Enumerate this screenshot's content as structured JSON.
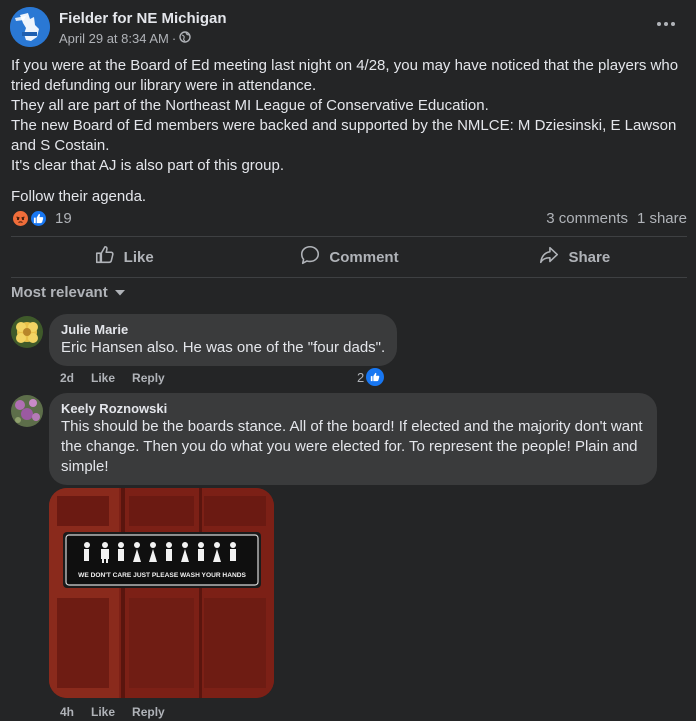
{
  "post": {
    "page_name": "Fielder for NE Michigan",
    "date": "April 29 at 8:34 AM",
    "separator": "·",
    "paragraphs": [
      "If you were at the Board of Ed meeting last night on 4/28, you may have noticed that the players who tried defunding our library were in attendance.",
      "They all are part of the Northeast MI League of Conservative Education.",
      "The new Board of Ed members were backed and supported by the NMLCE: M Dziesinski, E Lawson and S Costain.",
      "It's clear that AJ is also part of this group."
    ],
    "closing": "Follow their agenda.",
    "reaction_count": "19",
    "comments_count": "3 comments",
    "shares_count": "1 share"
  },
  "actions": {
    "like": "Like",
    "comment": "Comment",
    "share": "Share"
  },
  "sort": {
    "label": "Most relevant"
  },
  "comments": [
    {
      "author": "Julie Marie",
      "text": "Eric Hansen also. He was one of the \"four dads\".",
      "time": "2d",
      "like": "Like",
      "reply": "Reply",
      "reactions": "2"
    },
    {
      "author": "Keely Roznowski",
      "text": "This should be the boards stance. All of the board! If elected and the majority don't want the change. Then you do what you were elected for. To represent the people! Plain and simple!",
      "image_sign_text": "WE DON'T CARE JUST PLEASE WASH YOUR HANDS",
      "time": "4h",
      "like": "Like",
      "reply": "Reply"
    }
  ],
  "icons": {
    "globe": "globe-icon",
    "more": "more-icon",
    "like": "thumbs-up-icon",
    "comment": "comment-bubble-icon",
    "share": "share-arrow-icon",
    "dropdown": "chevron-down-icon"
  },
  "colors": {
    "background": "#242526",
    "bubble": "#3a3b3c",
    "like_blue": "#1877f2",
    "angry_orange": "#f06d3a",
    "text_primary": "#e4e6eb",
    "text_secondary": "#b0b3b8"
  }
}
